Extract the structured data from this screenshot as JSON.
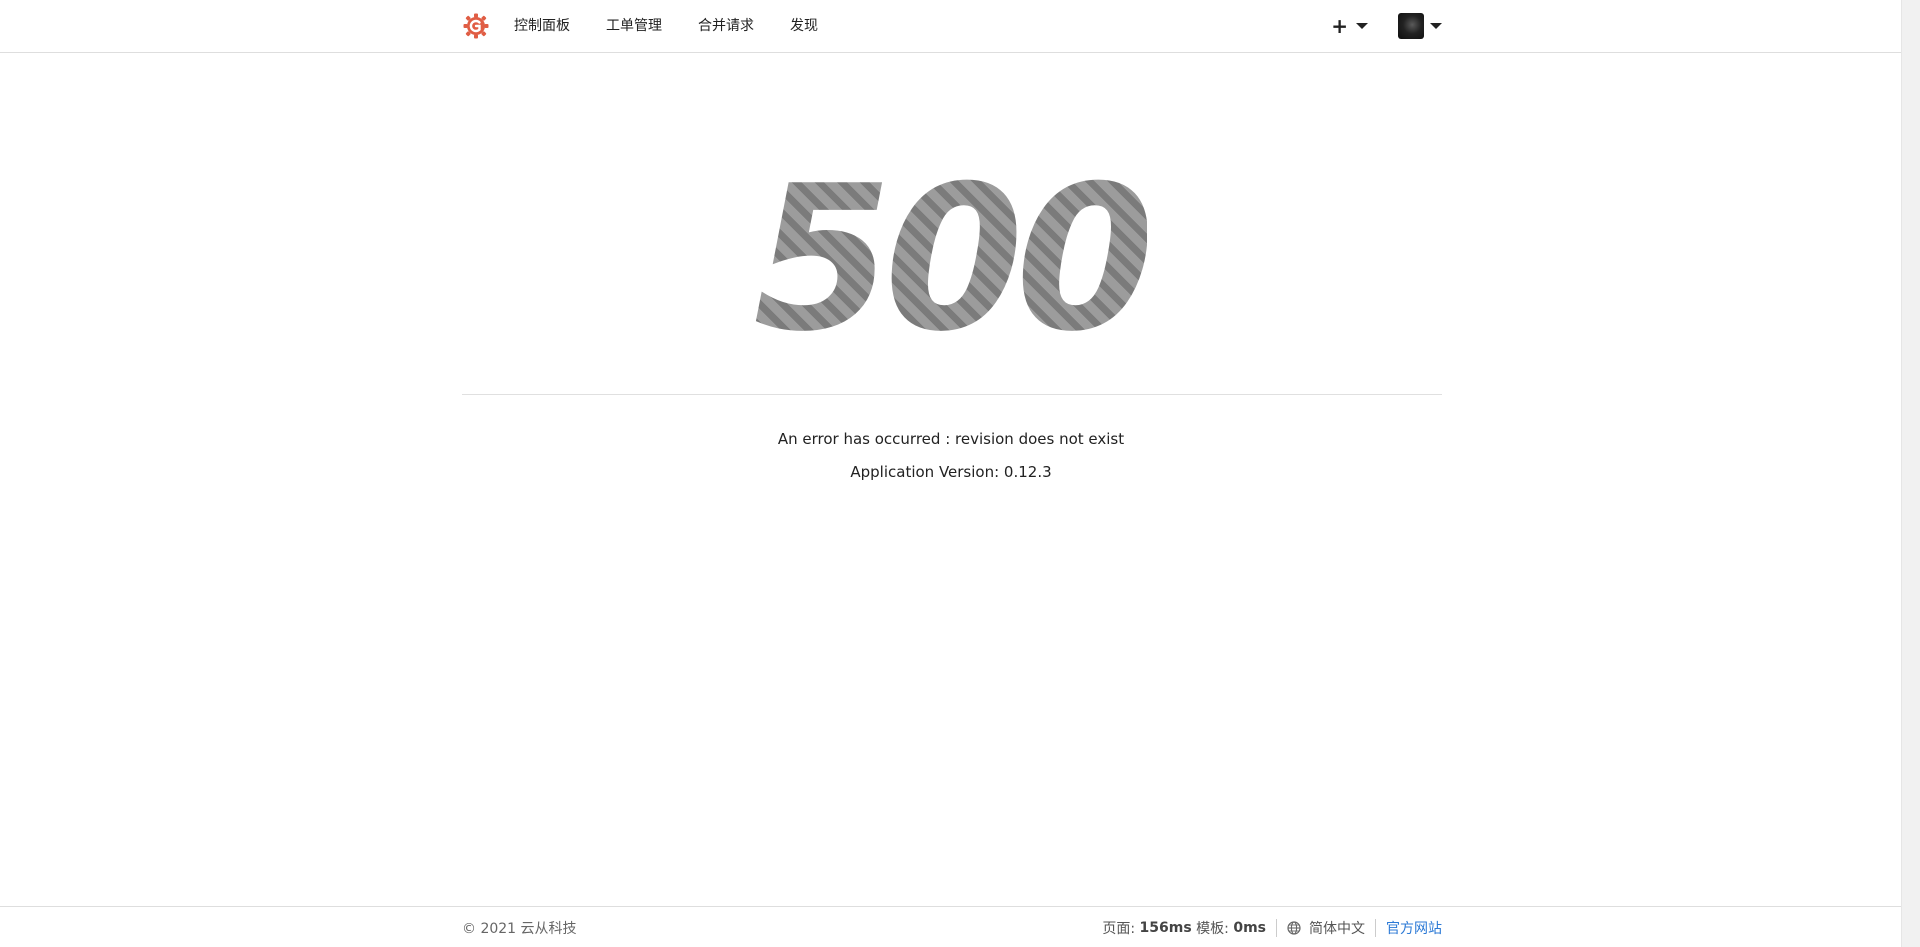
{
  "nav": {
    "logo_icon": "gitea-logo-icon",
    "brand_color": "#e05d44",
    "items": [
      {
        "label": "控制面板"
      },
      {
        "label": "工单管理"
      },
      {
        "label": "合并请求"
      },
      {
        "label": "发现"
      }
    ],
    "create_label": "+",
    "create_icon": "plus-icon",
    "dropdown_icon": "caret-down-icon",
    "avatar_icon": "user-avatar"
  },
  "error": {
    "code": "500",
    "message": "An error has occurred : revision does not exist",
    "version": "Application Version: 0.12.3"
  },
  "footer": {
    "copyright": "© 2021 云从科技",
    "page_label": "页面:",
    "page_time": "156ms",
    "template_label": "模板:",
    "template_time": "0ms",
    "language_icon": "globe-icon",
    "language": "简体中文",
    "official_site": "官方网站",
    "link_color": "#2c7ad6"
  }
}
